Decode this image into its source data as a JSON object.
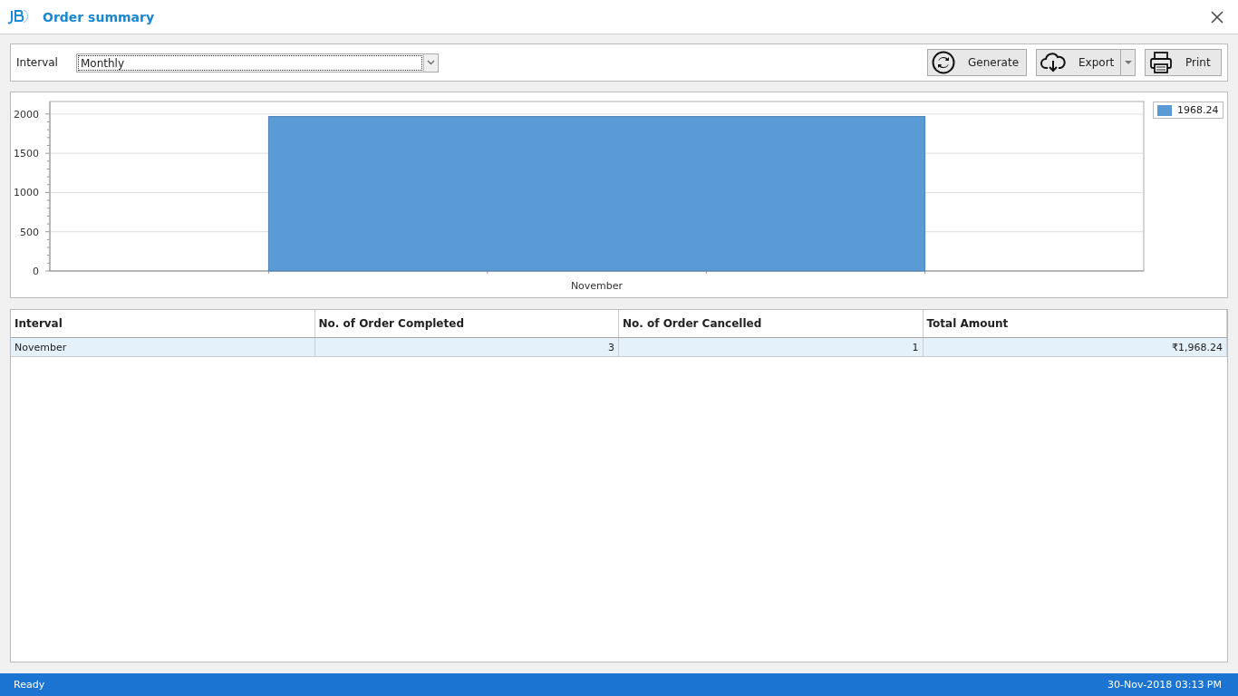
{
  "window": {
    "title": "Order summary"
  },
  "toolbar": {
    "interval_label": "Interval",
    "interval_value": "Monthly",
    "buttons": [
      {
        "label": "Generate",
        "kind": "generate"
      },
      {
        "label": "Export",
        "kind": "export"
      },
      {
        "label": "Print",
        "kind": "print"
      }
    ]
  },
  "chart": {
    "chart_data": {
      "type": "bar",
      "categories": [
        "November"
      ],
      "series": [
        {
          "name": "1968.24",
          "color": "#5b9bd5",
          "values": [
            1968.24
          ]
        }
      ],
      "ylim": [
        0,
        2160
      ],
      "yticks": [
        0,
        500,
        1000,
        1500,
        2000
      ],
      "grid": true
    }
  },
  "table": {
    "columns": [
      "Interval",
      "No. of Order Completed",
      "No. of Order Cancelled",
      "Total Amount"
    ],
    "rows": [
      {
        "cells": [
          "November",
          "3",
          "1",
          "₹1,968.24"
        ],
        "selected": true
      }
    ]
  },
  "status_bar": {
    "status": "Ready",
    "datetime": "30-Nov-2018 03:13 PM"
  }
}
